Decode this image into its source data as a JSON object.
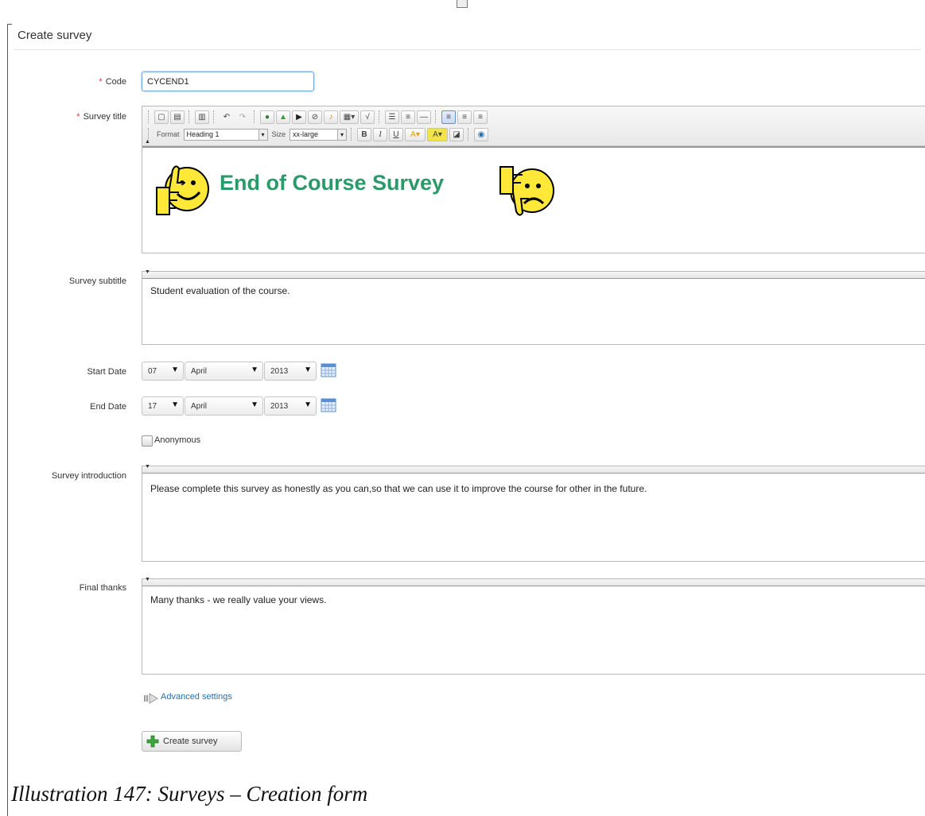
{
  "form": {
    "title": "Create survey"
  },
  "fields": {
    "code": {
      "label": "Code",
      "value": "CYCEND1"
    },
    "survey_title": {
      "label": "Survey title",
      "toolbar": {
        "format_label": "Format",
        "format_value": "Heading 1",
        "size_label": "Size",
        "size_value": "xx-large"
      },
      "content": "End of Course Survey"
    },
    "survey_subtitle": {
      "label": "Survey subtitle",
      "content": "Student evaluation of the course."
    },
    "start_date": {
      "label": "Start Date",
      "day": "07",
      "month": "April",
      "year": "2013"
    },
    "end_date": {
      "label": "End Date",
      "day": "17",
      "month": "April",
      "year": "2013"
    },
    "anonymous": {
      "label": "Anonymous",
      "checked": false
    },
    "survey_introduction": {
      "label": "Survey introduction",
      "content": "Please complete this survey as honestly as you can,so that we can use it to improve the course for other in the future."
    },
    "final_thanks": {
      "label": "Final thanks",
      "content": "Many thanks - we really value your views."
    }
  },
  "advanced_settings": {
    "label": "Advanced settings"
  },
  "submit": {
    "label": "Create survey"
  },
  "caption": "Illustration 147: Surveys – Creation form",
  "colors": {
    "heading": "#2a9a6a",
    "link": "#2a6fa8",
    "required": "#dd3333",
    "plus": "#3aa83a"
  }
}
